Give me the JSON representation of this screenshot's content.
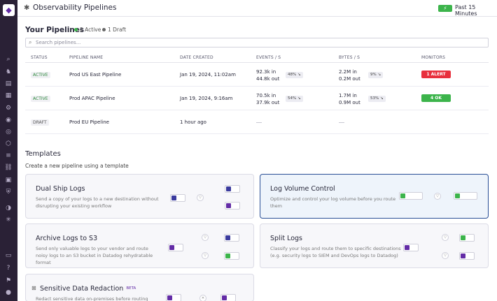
{
  "topbar": {
    "title": "Observability Pipelines",
    "time_range": "Past 15 Minutes"
  },
  "pipelines": {
    "title": "Your Pipelines",
    "active_badge": "2 Active",
    "draft_badge": "1 Draft",
    "search_placeholder": "Search pipelines...",
    "columns": [
      "STATUS",
      "PIPELINE NAME",
      "DATE CREATED",
      "EVENTS / S",
      "BYTES / S",
      "MONITORS"
    ],
    "rows": [
      {
        "status": "ACTIVE",
        "name": "Prod US East Pipeline",
        "date": "Jan 19, 2024, 11:02am",
        "events_in": "92.3k in",
        "events_out": "44.8k out",
        "events_pct": "48%",
        "bytes_in": "2.2M in",
        "bytes_out": "0.2M out",
        "bytes_pct": "9%",
        "monitor": "1 ALERT",
        "monitor_color": "#e8303d"
      },
      {
        "status": "ACTIVE",
        "name": "Prod APAC Pipeline",
        "date": "Jan 19, 2024, 9:16am",
        "events_in": "70.5k in",
        "events_out": "37.9k out",
        "events_pct": "54%",
        "bytes_in": "1.7M in",
        "bytes_out": "0.9M out",
        "bytes_pct": "53%",
        "monitor": "4 OK",
        "monitor_color": "#3cb44b"
      },
      {
        "status": "DRAFT",
        "name": "Prod EU Pipeline",
        "date": "1 hour ago"
      }
    ]
  },
  "templates": {
    "title": "Templates",
    "subtitle": "Create a new pipeline using a template",
    "cards": [
      {
        "title": "Dual Ship Logs",
        "desc": "Send a copy of your logs to a new destination without disrupting your existing workflow"
      },
      {
        "title": "Log Volume Control",
        "desc": "Optimize and control your log volume before you route them"
      },
      {
        "title": "Archive Logs to S3",
        "desc": "Send only valuable logs to your vendor and route noisy logs to an S3 bucket in Datadog rehydratable format"
      },
      {
        "title": "Split Logs",
        "desc": "Classify your logs and route them to specific destinations (e.g. security logs to SIEM and DevOps logs to Datadog)"
      },
      {
        "title": "Sensitive Data Redaction",
        "beta": "BETA",
        "desc": "Redact sensitive data on-premises before routing"
      }
    ]
  },
  "colors": {
    "sidebar": "#2a2136",
    "accent": "#632ca6",
    "alert": "#e8303d",
    "ok": "#3cb44b"
  }
}
